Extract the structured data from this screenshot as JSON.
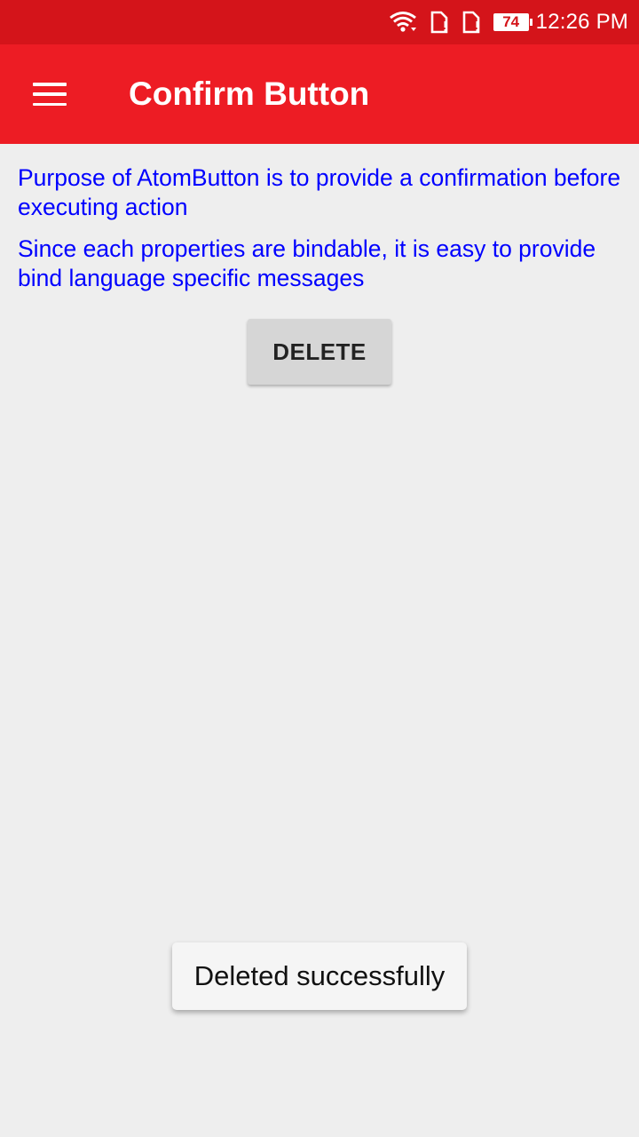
{
  "status_bar": {
    "time": "12:26 PM",
    "battery_level": "74",
    "icons": [
      "wifi-icon",
      "sim-card-icon",
      "sim-card-icon",
      "battery-icon"
    ],
    "background_color": "#d4141a"
  },
  "app_bar": {
    "title": "Confirm Button",
    "menu_icon": "hamburger-menu-icon",
    "background_color": "#ed1c24"
  },
  "content": {
    "paragraphs": [
      "Purpose of AtomButton is to provide a confirmation before executing action",
      "Since each properties are bindable, it is easy to provide bind language specific messages"
    ],
    "text_color": "#0000ff",
    "delete_button_label": "DELETE"
  },
  "toast": {
    "message": "Deleted successfully"
  }
}
